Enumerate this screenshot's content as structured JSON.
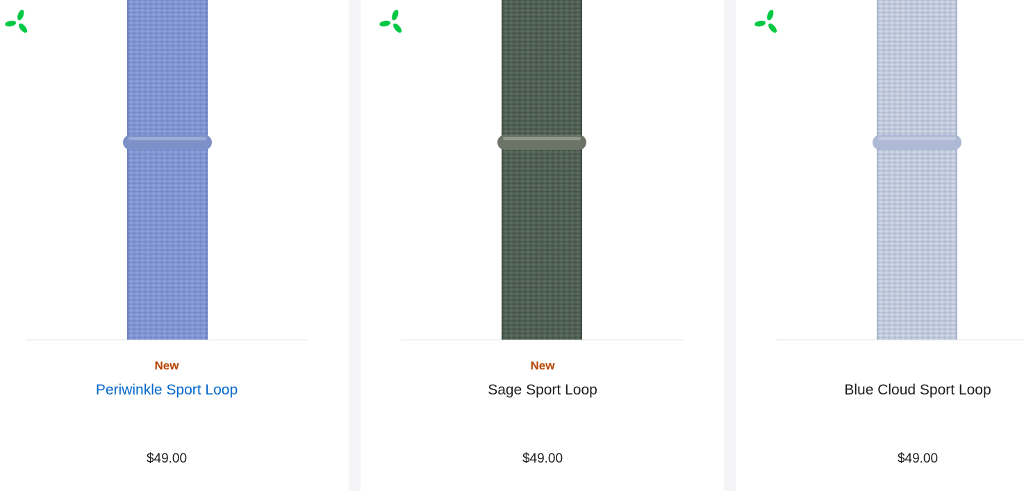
{
  "products": [
    {
      "badge": "New",
      "name": "Periwinkle Sport Loop",
      "price": "$49.00",
      "band_color": "#7b8fcf",
      "band_dark": "#5f72b5",
      "band_light": "#9aaae0",
      "clasp_color": "#7d90c8",
      "name_is_link": true
    },
    {
      "badge": "New",
      "name": "Sage Sport Loop",
      "price": "$49.00",
      "band_color": "#4a5a4f",
      "band_dark": "#35433a",
      "band_light": "#65766a",
      "clasp_color": "#6b7467",
      "name_is_link": false
    },
    {
      "badge": "",
      "name": "Blue Cloud Sport Loop",
      "price": "$49.00",
      "band_color": "#b9c3d8",
      "band_dark": "#9aa6c0",
      "band_light": "#dde3ef",
      "clasp_color": "#aeb9d6",
      "name_is_link": false
    }
  ],
  "icons": {
    "eco": "eco-leaf-icon",
    "eco_color": "#00c844"
  },
  "colors": {
    "badge": "#b64400",
    "link": "#0066cc",
    "text": "#1d1d1f",
    "background": "#f5f5f7"
  }
}
